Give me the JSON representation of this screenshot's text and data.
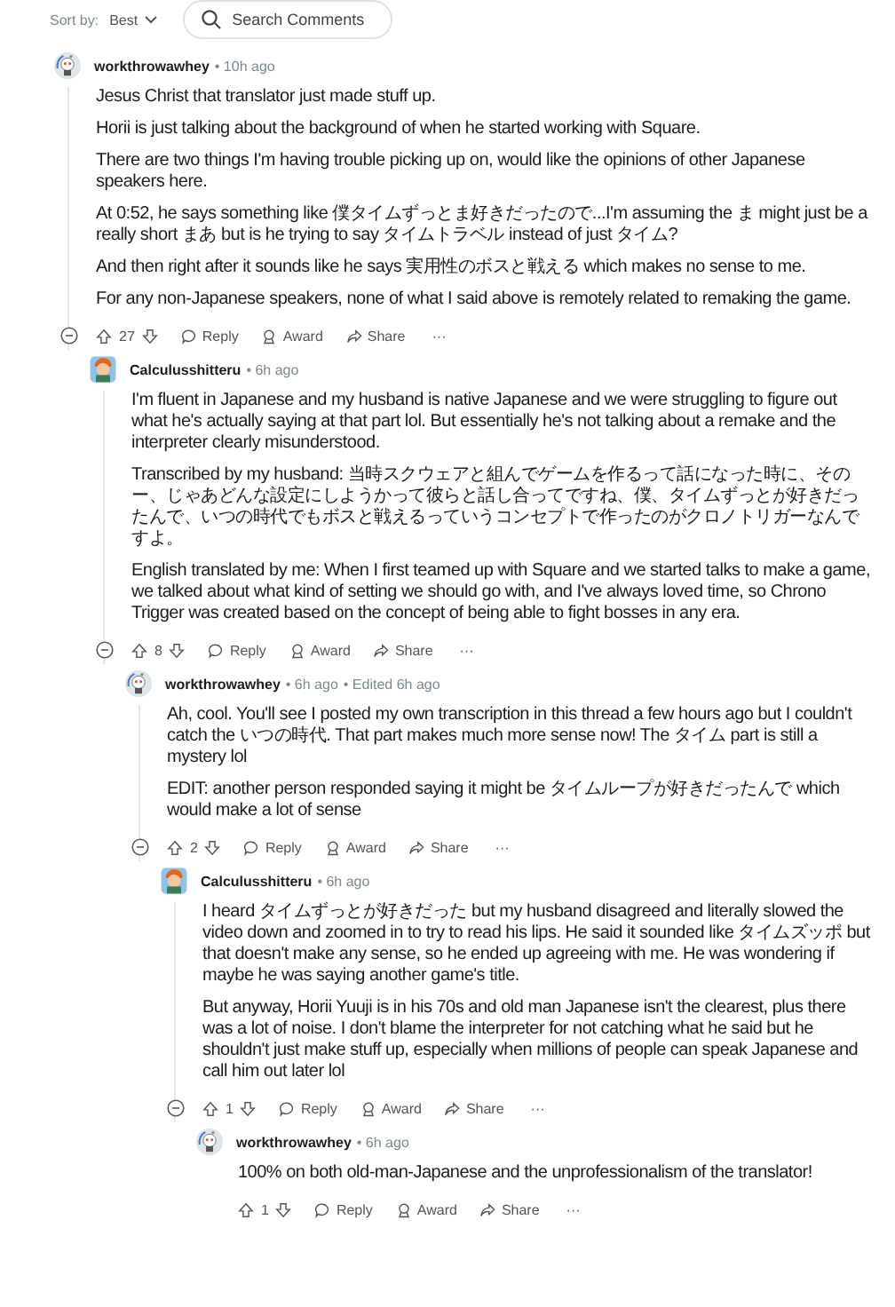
{
  "sort": {
    "label": "Sort by:",
    "value": "Best"
  },
  "search": {
    "placeholder": "Search Comments"
  },
  "comments": [
    {
      "author": "workthrowawhey",
      "kind": "snoo",
      "time": "• 10h ago",
      "votes": "27",
      "actions": [
        "Reply",
        "Award",
        "Share"
      ],
      "more": "···",
      "paragraphs": [
        "Jesus Christ that translator just made stuff up.",
        "Horii is just talking about the background of when he started working with Square.",
        "There are two things I'm having trouble picking up on, would like the opinions of other Japanese speakers here.",
        "At 0:52, he says something like 僕タイムずっとま好きだったので...I'm assuming the ま might just be a really short まあ but is he trying to say タイムトラベル instead of just タイム?",
        "And then right after it sounds like he says 実用性のボスと戦える which makes no sense to me.",
        "For any non-Japanese speakers, none of what I said above is remotely related to remaking the game."
      ],
      "replies": [
        {
          "author": "Calculusshitteru",
          "kind": "cartoon",
          "time": "• 6h ago",
          "votes": "8",
          "actions": [
            "Reply",
            "Award",
            "Share"
          ],
          "more": "···",
          "paragraphs": [
            "I'm fluent in Japanese and my husband is native Japanese and we were struggling to figure out what he's actually saying at that part lol. But essentially he's not talking about a remake and the interpreter clearly misunderstood.",
            "Transcribed by my husband: 当時スクウェアと組んでゲームを作るって話になった時に、そのー、じゃあどんな設定にしようかって彼らと話し合ってですね、僕、タイムずっとが好きだったんで、いつの時代でもボスと戦えるっていうコンセプトで作ったのがクロノトリガーなんですよ。",
            "English translated by me: When I first teamed up with Square and we started talks to make a game, we talked about what kind of setting we should go with, and I've always loved time, so Chrono Trigger was created based on the concept of being able to fight bosses in any era."
          ],
          "replies": [
            {
              "author": "workthrowawhey",
              "kind": "snoo",
              "time": "• 6h ago",
              "edited": "• Edited 6h ago",
              "votes": "2",
              "actions": [
                "Reply",
                "Award",
                "Share"
              ],
              "more": "···",
              "paragraphs": [
                "Ah, cool. You'll see I posted my own transcription in this thread a few hours ago but I couldn't catch the いつの時代. That part makes much more sense now! The タイム part is still a mystery lol",
                "EDIT: another person responded saying it might be タイムループが好きだったんで which would make a lot of sense"
              ],
              "replies": [
                {
                  "author": "Calculusshitteru",
                  "kind": "cartoon",
                  "time": "• 6h ago",
                  "votes": "1",
                  "actions": [
                    "Reply",
                    "Award",
                    "Share"
                  ],
                  "more": "···",
                  "paragraphs": [
                    "I heard タイムずっとが好きだった but my husband disagreed and literally slowed the video down and zoomed in to try to read his lips. He said it sounded like タイムズッポ but that doesn't make any sense, so he ended up agreeing with me. He was wondering if maybe he was saying another game's title.",
                    "But anyway, Horii Yuuji is in his 70s and old man Japanese isn't the clearest, plus there was a lot of noise. I don't blame the interpreter for not catching what he said but he shouldn't just make stuff up, especially when millions of people can speak Japanese and call him out later lol"
                  ],
                  "replies": [
                    {
                      "author": "workthrowawhey",
                      "kind": "snoo",
                      "time": "• 6h ago",
                      "votes": "1",
                      "actions": [
                        "Reply",
                        "Award",
                        "Share"
                      ],
                      "more": "···",
                      "paragraphs": [
                        "100% on both old-man-Japanese and the unprofessionalism of the translator!"
                      ]
                    }
                  ]
                }
              ]
            }
          ]
        }
      ]
    }
  ]
}
